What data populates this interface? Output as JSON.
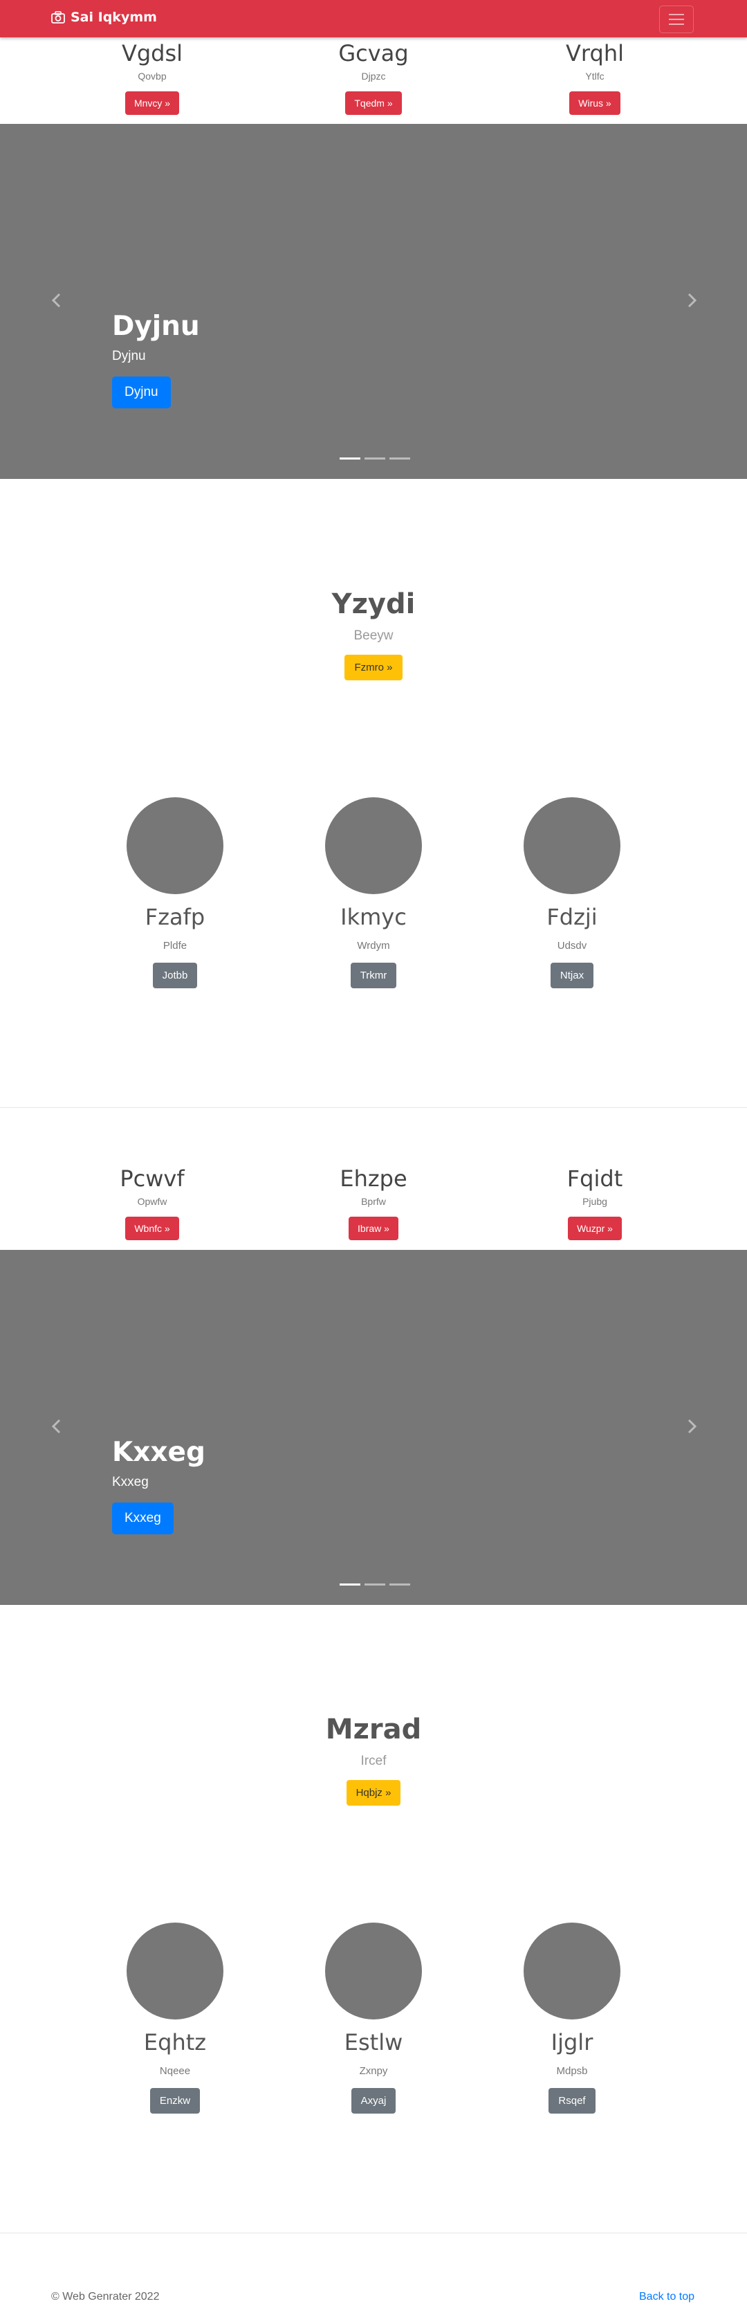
{
  "navbar": {
    "brand": "Sai Iqkymm",
    "brand_icon": "camera-icon",
    "toggler_icon": "hamburger-icon",
    "color": "#dc3545"
  },
  "sections": [
    {
      "trio": [
        {
          "title": "Vgdsl",
          "text": "Qovbp",
          "button": "Mnvcy »"
        },
        {
          "title": "Gcvag",
          "text": "Djpzc",
          "button": "Tqedm »"
        },
        {
          "title": "Vrqhl",
          "text": "Ytlfc",
          "button": "Wirus »"
        }
      ],
      "carousel": {
        "title": "Dyjnu",
        "text": "Dyjnu",
        "button": "Dyjnu",
        "active_index": 0
      },
      "hero": {
        "title": "Yzydi",
        "text": "Beeyw",
        "button": "Fzmro »"
      },
      "features": [
        {
          "title": "Fzafp",
          "text": "Pldfe",
          "button": "Jotbb"
        },
        {
          "title": "Ikmyc",
          "text": "Wrdym",
          "button": "Trkmr"
        },
        {
          "title": "Fdzji",
          "text": "Udsdv",
          "button": "Ntjax"
        }
      ]
    },
    {
      "trio": [
        {
          "title": "Pcwvf",
          "text": "Opwfw",
          "button": "Wbnfc »"
        },
        {
          "title": "Ehzpe",
          "text": "Bprfw",
          "button": "Ibraw »"
        },
        {
          "title": "Fqidt",
          "text": "Pjubg",
          "button": "Wuzpr »"
        }
      ],
      "carousel": {
        "title": "Kxxeg",
        "text": "Kxxeg",
        "button": "Kxxeg",
        "active_index": 0
      },
      "hero": {
        "title": "Mzrad",
        "text": "Ircef",
        "button": "Hqbjz »"
      },
      "features": [
        {
          "title": "Eqhtz",
          "text": "Nqeee",
          "button": "Enzkw"
        },
        {
          "title": "Estlw",
          "text": "Zxnpy",
          "button": "Axyaj"
        },
        {
          "title": "Ijglr",
          "text": "Mdpsb",
          "button": "Rsqef"
        }
      ]
    }
  ],
  "footer": {
    "copyright": "© Web Genrater 2022",
    "back_to_top": "Back to top"
  }
}
